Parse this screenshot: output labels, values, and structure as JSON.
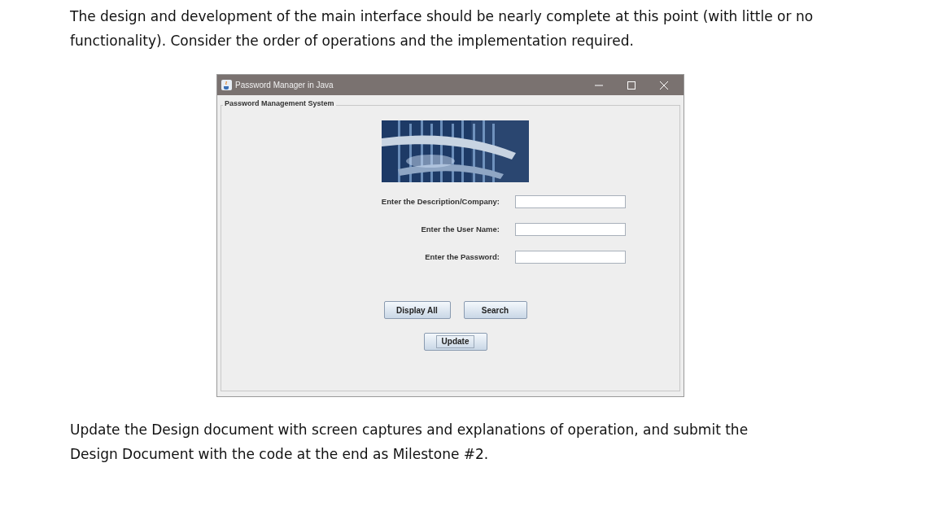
{
  "intro_text": "The design and development of the main interface should be nearly complete at this point (with little or no functionality). Consider the order of operations and the implementation required.",
  "window": {
    "title": "Password Manager in Java",
    "group_title": "Password Management System",
    "fields": [
      {
        "label": "Enter the Description/Company:"
      },
      {
        "label": "Enter the User Name:"
      },
      {
        "label": "Enter the Password:"
      }
    ],
    "buttons": [
      {
        "label": "Display All",
        "focused": false
      },
      {
        "label": "Search",
        "focused": false
      }
    ],
    "bottom_button": {
      "label": "Update",
      "focused": true
    }
  },
  "closing_text": "Update the Design document with screen captures and explanations of operation, and submit the Design Document with the code at the end as Milestone #2."
}
